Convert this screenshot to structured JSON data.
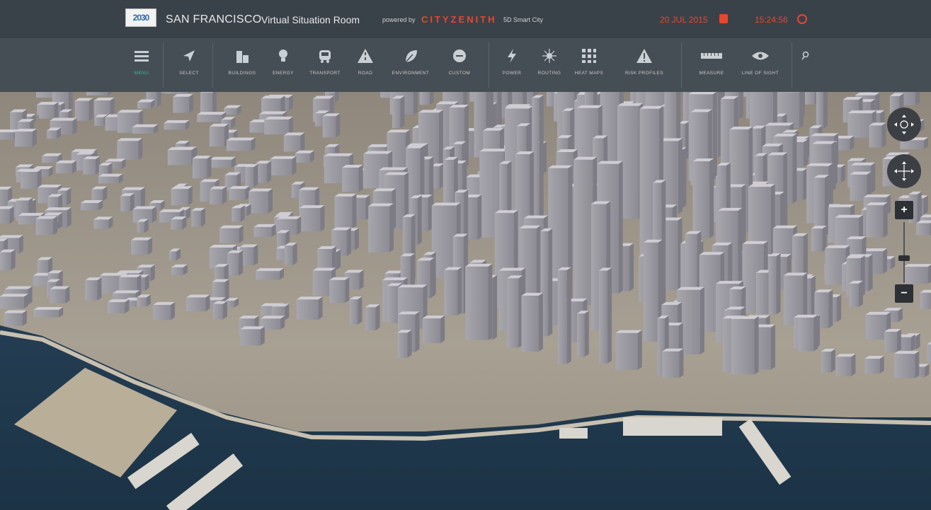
{
  "header": {
    "logo_text": "2030",
    "city": "SAN FRANCISCO",
    "room": "Virtual Situation Room",
    "powered": "powered by",
    "brand": "CITYZENITH",
    "smart": "5D Smart City",
    "date": "20 JUL 2015",
    "time": "15:24:56",
    "accent": "#e8462e"
  },
  "toolbar": {
    "active_color": "#3cb5a0",
    "items": [
      {
        "label": "MENU",
        "icon": "menu-icon"
      },
      {
        "label": "SELECT",
        "icon": "cursor-icon"
      },
      {
        "label": "BUILDINGS",
        "icon": "buildings-icon"
      },
      {
        "label": "ENERGY",
        "icon": "lightbulb-icon"
      },
      {
        "label": "TRANSPORT",
        "icon": "bus-icon"
      },
      {
        "label": "ROAD",
        "icon": "road-icon"
      },
      {
        "label": "ENVIRONMENT",
        "icon": "leaf-icon"
      },
      {
        "label": "CUSTOM",
        "icon": "custom-icon"
      },
      {
        "label": "POWER",
        "icon": "lightning-icon"
      },
      {
        "label": "ROUTING",
        "icon": "routing-icon"
      },
      {
        "label": "HEAT MAPS",
        "icon": "grid-icon"
      },
      {
        "label": "RISK PROFILES",
        "icon": "warning-icon"
      },
      {
        "label": "MEASURE",
        "icon": "ruler-icon"
      },
      {
        "label": "LINE OF SIGHT",
        "icon": "eye-icon"
      }
    ],
    "search_icon": "search-icon"
  },
  "map": {
    "controls": {
      "zoom_in": "+",
      "zoom_out": "−"
    }
  }
}
